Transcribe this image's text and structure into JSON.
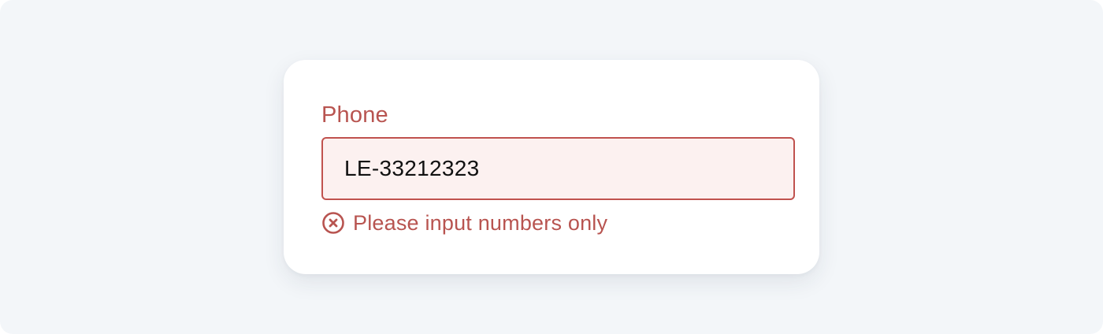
{
  "form": {
    "phone_label": "Phone",
    "phone_value": "LE-33212323",
    "error_message": "Please input numbers only",
    "error_icon": "close-circle-icon"
  },
  "colors": {
    "background": "#f3f6f9",
    "card": "#ffffff",
    "error": "#b85450",
    "error_border": "#c0524e",
    "input_error_bg": "#fcf1f0"
  }
}
